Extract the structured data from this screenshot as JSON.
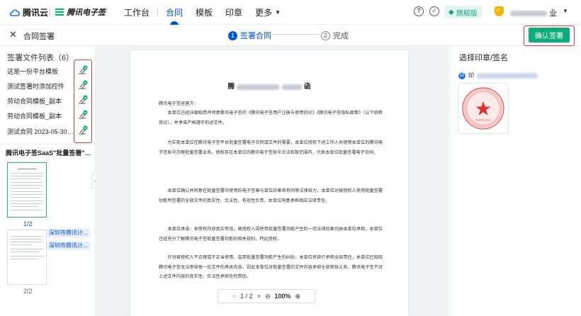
{
  "brand": {
    "cloud_logo": "腾讯云",
    "esign_logo": "腾讯电子签"
  },
  "nav": {
    "items": [
      "工作台",
      "合同",
      "模板",
      "印章",
      "更多"
    ],
    "active": "合同"
  },
  "header": {
    "flagship": "旗舰版",
    "org_name": "深圳市腾讯计算机系统有限公司",
    "org_visible_end": "业"
  },
  "stepbar": {
    "title": "合同签署",
    "step1": {
      "num": "1",
      "label": "签署合同"
    },
    "step2": {
      "num": "2",
      "label": "完成"
    },
    "confirm": "确认签署"
  },
  "left": {
    "list_title": "签署文件列表（6）",
    "files": [
      "这是一份平台模板",
      "测试签署时添加控件",
      "劳动合同模板_副本",
      "劳动合同模板_副本",
      "测试合同 2023-05-30 14:42..."
    ],
    "batch_title": "腾讯电子签SaaS\"批量签署\"功能开通...",
    "page1": "1/2",
    "page2": "2/2",
    "seal_tags": [
      "深圳市腾讯计...",
      "深圳市腾讯计..."
    ]
  },
  "doc": {
    "title_start": "腾",
    "title_end": "函",
    "greeting": "腾讯电子签运营方：",
    "paragraphs": [
      "本单位已经详细知悉并同意腾讯电子签的《腾讯电子签用户注册与使用协议》《腾讯电子签隐私政策》（以下统称协议），并承诺严格遵守前述文件。",
      "为实现本单位在腾讯电子签平台批量签署电子合同或文件的需要，本单位授权下述工作人员使用本单位的腾讯电子签账号办理批量签署业务。授权其在本单位的腾讯电子签账号合法权限范围内，代表本单位批量签署电子合同。",
      "本单位确认并同意在批量签署中使用的电子签章与单位印章具有同等法律效力，本单位对被授权人使用批量签署功能所签署的全部文件的真实性、合法性、有效性负责，本单位同意承担相应法律责任。",
      "本单位承诺：本授权内容真实有效，被授权人因使用批量签署功能产生的一切法律后果均由本单位承担。本单位已经充分了解腾讯电子签批量签署功能的相关规则，特此授权。",
      "针对被授权人不合理或不正当使用、滥用批量签署功能产生的纠纷，本单位将自行承担全部责任，本单位已知晓腾讯电子签无法审核每一份文件的具体内容，因此本单位对批量签署的文件内容承担全部审核义务，腾讯电子签不对上述文件内容的真实性、合法性承担任何责任。"
    ],
    "pager": {
      "prev": "<",
      "page": "1 / 2",
      "next": ">",
      "zoom_out": "⊖",
      "zoom": "100%",
      "zoom_in": "⊕"
    }
  },
  "right": {
    "title": "选择印章/签名",
    "org_badge": "印",
    "org_prefix": "印"
  }
}
